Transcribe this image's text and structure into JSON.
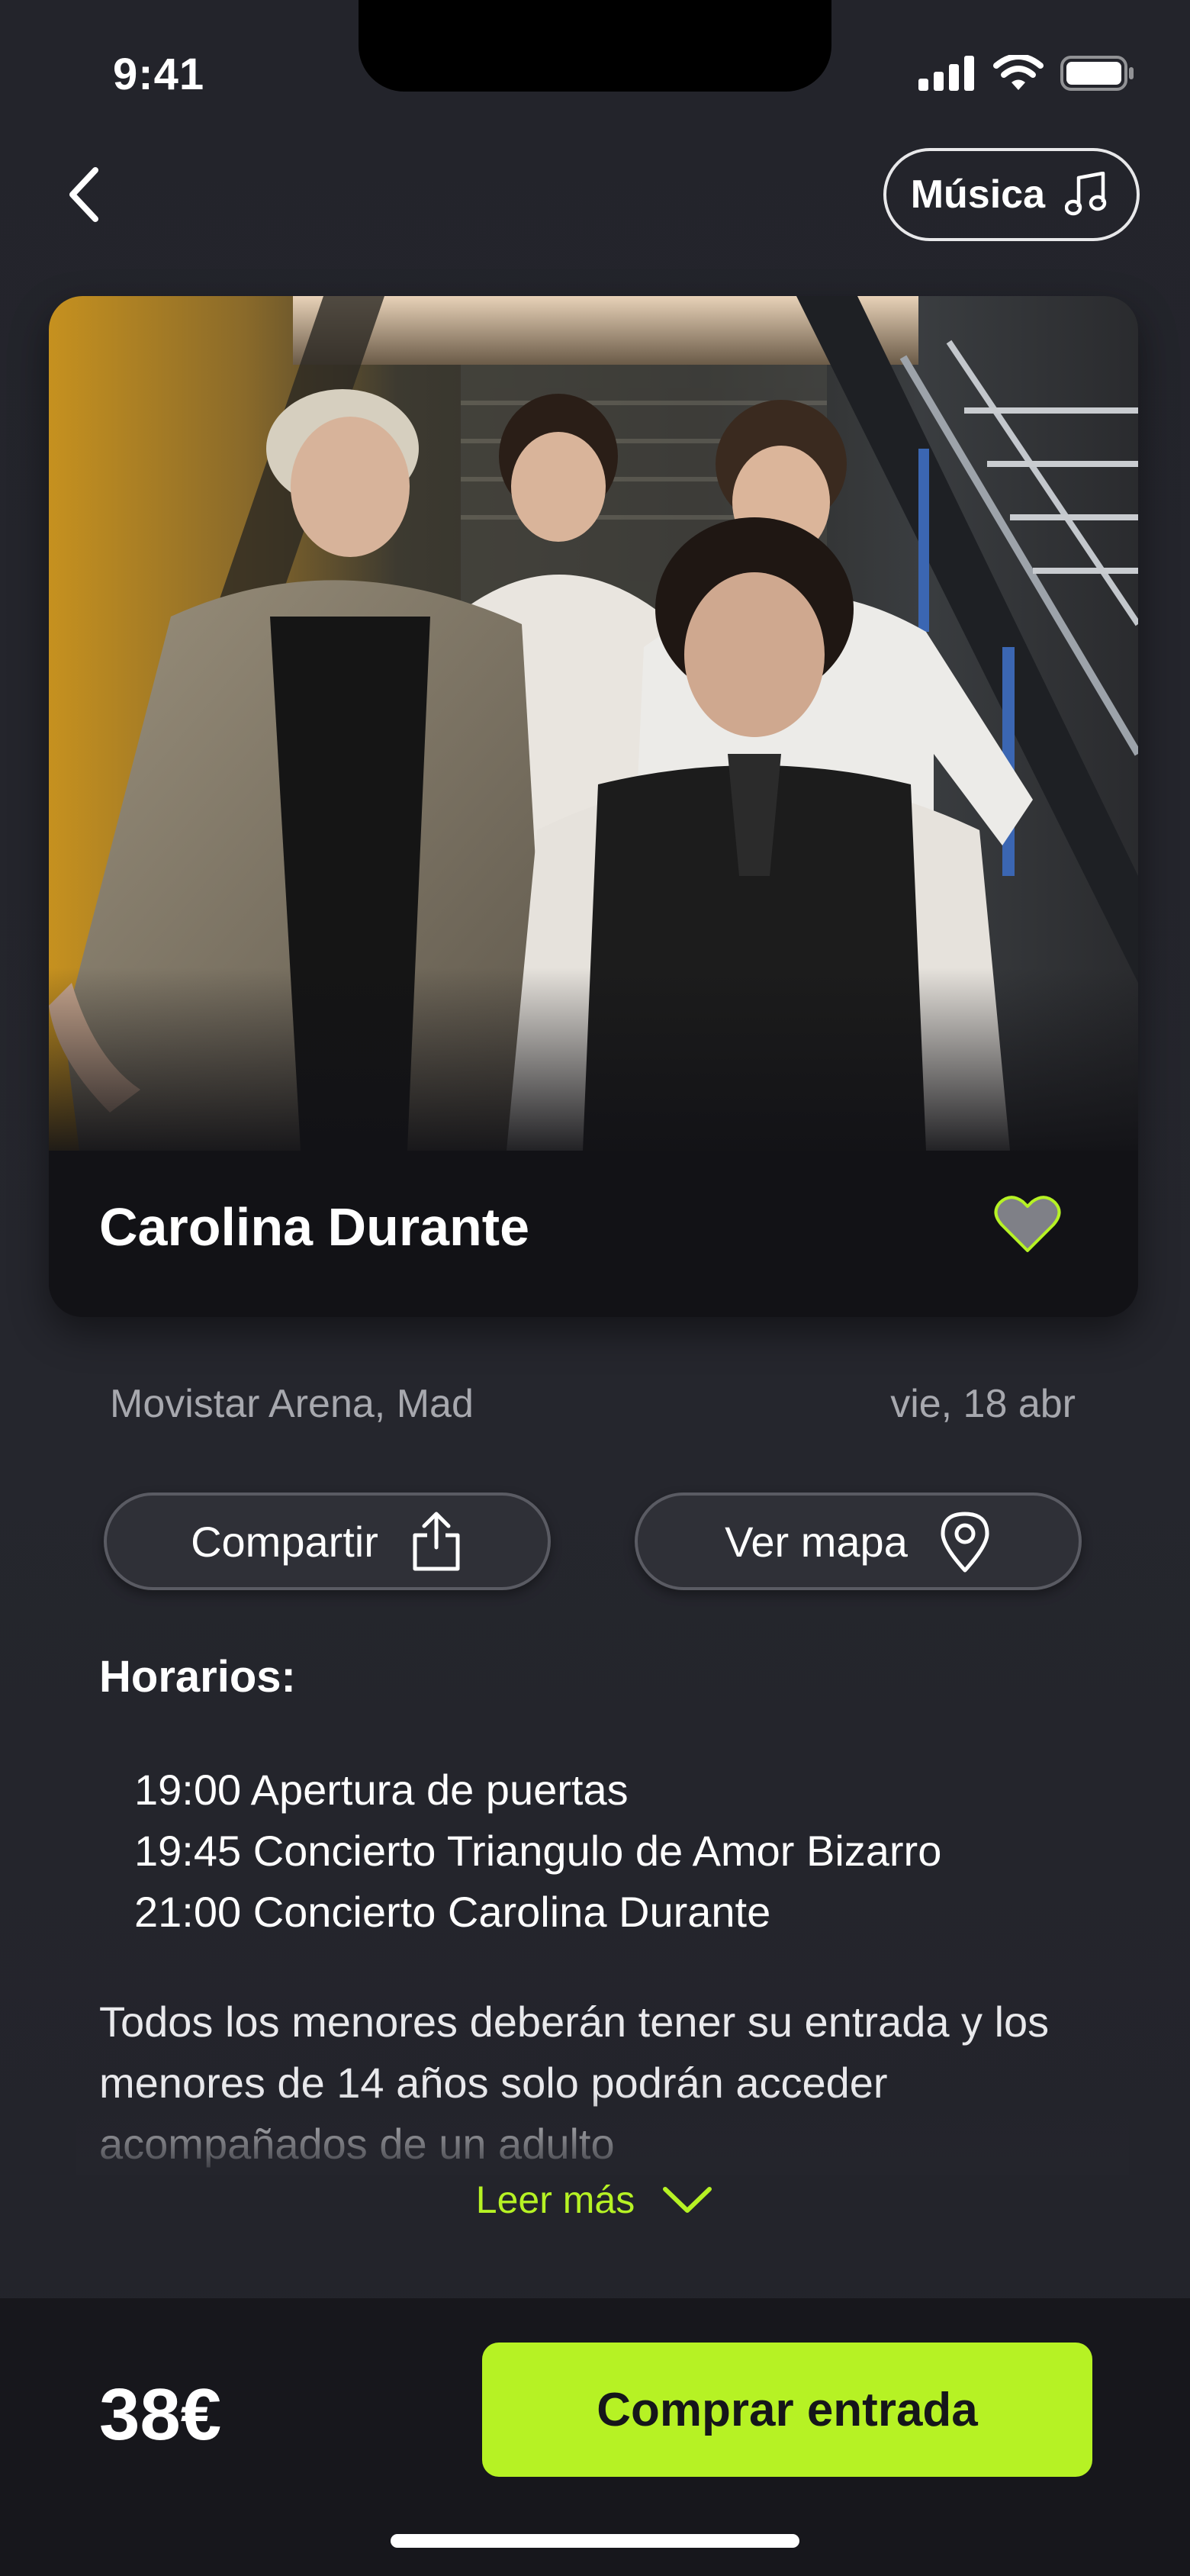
{
  "status_bar": {
    "time": "9:41"
  },
  "header": {
    "back_icon": "chevron-left-icon",
    "category_label": "Música",
    "category_icon": "music-note-icon"
  },
  "event": {
    "title": "Carolina Durante",
    "favorite_icon": "heart-icon",
    "venue": "Movistar Arena, Mad",
    "date": "vie, 18 abr"
  },
  "actions": {
    "share_label": "Compartir",
    "share_icon": "share-icon",
    "map_label": "Ver mapa",
    "map_icon": "map-pin-icon"
  },
  "schedule": {
    "title": "Horarios:",
    "items": [
      "19:00 Apertura de puertas",
      "19:45 Concierto Triangulo de Amor Bizarro",
      "21:00 Concierto Carolina Durante"
    ]
  },
  "description": {
    "text": "Todos los menores deberán tener su entrada y los menores de 14 años solo podrán acceder acompañados de un adulto",
    "read_more_label": "Leer más",
    "read_more_icon": "chevron-down-icon"
  },
  "purchase": {
    "price": "38€",
    "buy_label": "Comprar entrada"
  },
  "colors": {
    "background": "#24252c",
    "accent": "#b6f224",
    "muted_text": "#a7a8ae",
    "card": "#121216",
    "bottom_bar": "#17171c"
  }
}
